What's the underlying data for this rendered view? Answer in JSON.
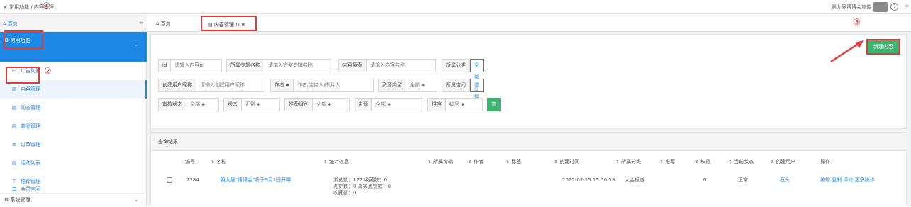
{
  "topbar": {
    "breadcrumb": "✔ 常用功能 / 内容管理",
    "user": "第九届博博会宣传",
    "help_icon": "?",
    "logout_icon": "⇥"
  },
  "sidebar": {
    "home": "⌂ 首页",
    "menu_icon": "≡",
    "group_label": "⚙ 常用功能",
    "group_arrow": "⌃",
    "items": [
      {
        "icon": "▭",
        "label": "广告列表"
      },
      {
        "icon": "▤",
        "label": "内容管理"
      },
      {
        "icon": "▤",
        "label": "动态管理"
      },
      {
        "icon": "▥",
        "label": "商品管理"
      },
      {
        "icon": "≡",
        "label": "订单管理"
      },
      {
        "icon": "▤",
        "label": "活动列表"
      },
      {
        "icon": "⊤",
        "label": "推荐管理"
      },
      {
        "icon": "☰",
        "label": "会员空间"
      }
    ],
    "system": "⚙ 系统管理",
    "system_arrow": "⌄"
  },
  "tabs": {
    "home": "⌂ 首页",
    "content": "▤ 内容管理 ↻ ✕"
  },
  "toolbar": {
    "new_label": "新建内容"
  },
  "filters": {
    "id_label": "id",
    "id_ph": "请输入内容id",
    "special_label": "所属专辑名称",
    "special_ph": "请输入完整专辑名称",
    "search_label": "内容搜索",
    "search_ph": "请输入内容名称",
    "category_label": "所属分类",
    "category_value": "全部 ⊙",
    "creator_label": "创建用户昵称",
    "creator_ph": "请输入创建用户昵称",
    "author_label": "作者 ⬥",
    "author_ph": "作者/主持人/制片人",
    "type_label": "资源类型",
    "type_value": "全部 ⬥",
    "space_label": "所属空间",
    "space_value": "选择 ⊙",
    "audit_label": "审核状态",
    "audit_value": "全部 ⬥",
    "status_label": "状态",
    "status_value": "正常 ⬥",
    "rec_label": "推荐级别",
    "rec_value": "全部 ⬥",
    "source_label": "来源",
    "source_value": "全部 ⬥",
    "sort_label": "排序",
    "sort_value": "编号 ⬥",
    "search_btn": "查询"
  },
  "results": {
    "title": "查询结果",
    "headers": [
      "编号",
      "⇕ 名称",
      "⇕ 统计信息",
      "⇕ 所属专辑",
      "⇕ 作者",
      "⇕ 标签",
      "⇕ 创建时间",
      "⇕ 所属分类",
      "⇕ 推荐",
      "⇕ 权重",
      "⇕ 当前状态",
      "⇕ 创建用户",
      "操作"
    ],
    "row": {
      "id": "2284",
      "name": "第九届\"博博会\"将于9月1日开幕",
      "stats1": "浏览数：122  收藏数：0",
      "stats2": "点赞数：0  真实点赞数：0",
      "stats3": "收藏数：0",
      "created": "2022-07-15 15:50:59",
      "category": "大会报道",
      "weight": "0",
      "status": "正常",
      "user": "石头",
      "actions": "编辑  复制  评论  更多操作"
    }
  },
  "annotations": {
    "a1": "①",
    "a2": "②",
    "a3": "③"
  }
}
